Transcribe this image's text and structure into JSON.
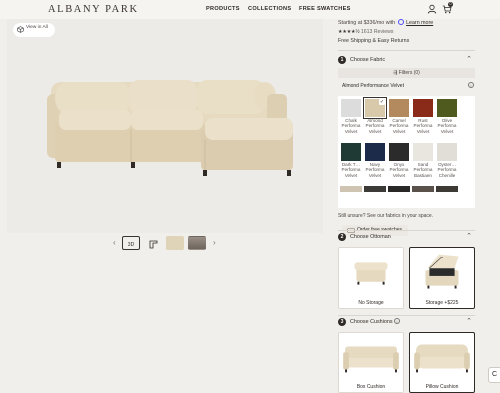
{
  "header": {
    "logo": "ALBANY PARK",
    "nav": [
      "PRODUCTS",
      "COLLECTIONS",
      "FREE SWATCHES"
    ],
    "cart_count": "0"
  },
  "gallery": {
    "view_in_label": "View in All",
    "thumbnails": [
      "3D view",
      "Dimensions",
      "Fabric",
      "Lifestyle"
    ]
  },
  "product": {
    "price_line": "Starting at $336/mo with",
    "learn_more": "Learn more",
    "rating_stars": "★★★★½",
    "reviews": "1613 Reviews",
    "shipping": "Free Shipping & Easy Returns"
  },
  "fabric": {
    "step": "1",
    "title": "Choose Fabric",
    "filters": "Filters (0)",
    "selected_name": "Almond Performance Velvet",
    "swatches": [
      {
        "name": "Chalk",
        "sub": "Performa",
        "color": "#dcdcdc"
      },
      {
        "name": "Almond",
        "sub": "Performa",
        "color": "#d8c9aa",
        "selected": true
      },
      {
        "name": "Camel",
        "sub": "Performa",
        "color": "#b38a5e"
      },
      {
        "name": "Rust",
        "sub": "Performa",
        "color": "#8a2a18"
      },
      {
        "name": "Olive",
        "sub": "Performa",
        "color": "#4e5a1e"
      },
      {
        "name": "Dark T…",
        "sub": "Performa",
        "color": "#1f3a35"
      },
      {
        "name": "Navy",
        "sub": "Performa",
        "color": "#1d2b4a"
      },
      {
        "name": "Onyx",
        "sub": "Performa",
        "color": "#2b2b2b"
      },
      {
        "name": "Sand",
        "sub": "Performa",
        "color": "#e9e6df"
      },
      {
        "name": "Oyster…",
        "sub": "Performa",
        "color": "#e1ded8"
      }
    ],
    "swatch_subline2": [
      "Velvet",
      "Velvet",
      "Velvet",
      "Velvet",
      "Velvet",
      "Velvet",
      "Velvet",
      "Velvet",
      "Bastiaen",
      "Chenille"
    ],
    "unsure": "Still unsure? See our fabrics in your space.",
    "order_swatches": "Order free swatches"
  },
  "ottoman": {
    "step": "2",
    "title": "Choose Ottoman",
    "options": [
      {
        "label": "No Storage"
      },
      {
        "label": "Storage +$225",
        "selected": true
      }
    ]
  },
  "cushions": {
    "step": "3",
    "title": "Choose Cushions",
    "options": [
      {
        "label": "Box Cushion"
      },
      {
        "label": "Pillow Cushion",
        "selected": true
      }
    ]
  },
  "chat_label": "C",
  "colors": {
    "fabric": "#e3d6bc",
    "fabric_shadow": "#cdbd9c",
    "dark": "#2f2a26"
  }
}
